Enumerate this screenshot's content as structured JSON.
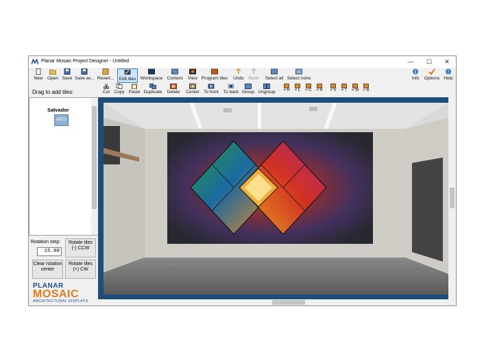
{
  "window": {
    "title": "Planar Mosaic Project Designer - Untitled",
    "controls": {
      "minimize": "—",
      "maximize": "☐",
      "close": "✕"
    }
  },
  "toolbar": {
    "new": "New",
    "open": "Open",
    "save": "Save",
    "save_as": "Save as...",
    "revert": "Revert...",
    "edit_tiles": "Edit tiles",
    "workspace": "Workspace",
    "content": "Content",
    "view": "View",
    "program_tiles": "Program tiles",
    "undo": "Undo",
    "redo": "Redo",
    "select_all": "Select all",
    "select_none": "Select none",
    "info": "Info",
    "options": "Options",
    "help": "Help"
  },
  "edit_toolbar": {
    "cut": "Cut",
    "copy": "Copy",
    "paste": "Paste",
    "duplicate": "Duplicate",
    "delete": "Delete",
    "center": "Center",
    "to_front": "To front",
    "to_back": "To back",
    "group": "Group",
    "ungroup": "Ungroup",
    "align": [
      "= H",
      "= L",
      "= C",
      "= R",
      "= V",
      "= T",
      "= M",
      "= B"
    ]
  },
  "left_panel": {
    "drag_label": "Drag to add tiles:",
    "group_name": "Salvador",
    "tile_label": "AB22"
  },
  "rotation": {
    "label": "Rotation step:",
    "value": "15.00",
    "rotate_ccw": "Rotate tiles (-) CCW",
    "rotate_cw": "Rotate tiles (+) CW",
    "clear_center": "Clear rotation center"
  },
  "logo": {
    "line1": "PLANAR",
    "line2": "MOSAIC",
    "line3": "ARCHITECTURAL DISPLAYS"
  },
  "colors": {
    "canvas_border": "#1f4d7a",
    "active_tool": "#cce4f7",
    "logo_blue": "#1a4a8a",
    "logo_orange": "#e37a1b"
  }
}
